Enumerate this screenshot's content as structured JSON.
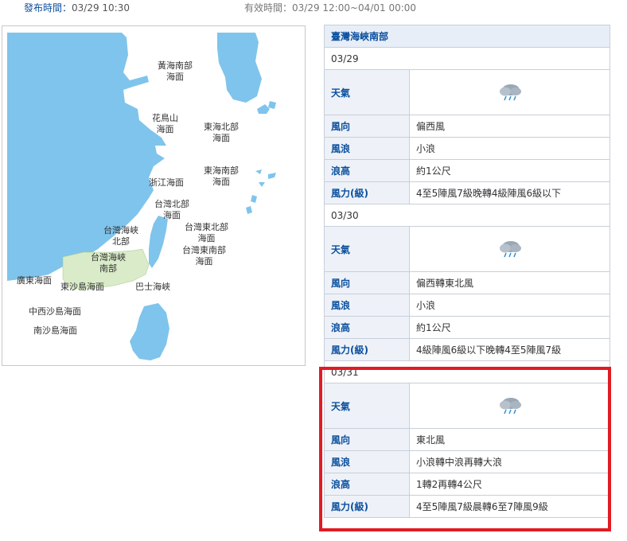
{
  "header": {
    "publish_label": "發布時間：",
    "publish_time": "03/29 10:30",
    "valid_label": "有效時間：",
    "valid_time": "03/29 12:00~04/01 00:00"
  },
  "map": {
    "regions": {
      "yellow_sea_south_a": "黃海南部",
      "yellow_sea_south_b": "海面",
      "huaniao_a": "花鳥山",
      "huaniao_b": "海面",
      "east_china_north_a": "東海北部",
      "east_china_north_b": "海面",
      "east_china_south_a": "東海南部",
      "east_china_south_b": "海面",
      "zhejiang": "浙江海面",
      "taiwan_north_a": "台灣北部",
      "taiwan_north_b": "海面",
      "taiwan_strait_north_a": "台灣海峽",
      "taiwan_strait_north_b": "北部",
      "taiwan_strait_south_a": "台灣海峽",
      "taiwan_strait_south_b": "南部",
      "taiwan_northeast_a": "台灣東北部",
      "taiwan_northeast_b": "海面",
      "taiwan_southeast_a": "台灣東南部",
      "taiwan_southeast_b": "海面",
      "guangdong": "廣東海面",
      "dongsha": "東沙島海面",
      "bashi": "巴士海峽",
      "zhongxisha": "中西沙島海面",
      "nansha": "南沙島海面"
    },
    "colors": {
      "land": "#7fc4ec",
      "selected": "#d9ebc8"
    }
  },
  "forecast": {
    "region_title": "臺灣海峽南部",
    "labels": {
      "weather": "天氣",
      "wind_dir": "風向",
      "wave": "風浪",
      "wave_height": "浪高",
      "wind_force": "風力(級)"
    },
    "days": [
      {
        "date": "03/29",
        "weather_icon": "rain-cloud-icon",
        "wind_dir": "偏西風",
        "wave": "小浪",
        "wave_height": "約1公尺",
        "wind_force": "4至5陣風7級晚轉4級陣風6級以下"
      },
      {
        "date": "03/30",
        "weather_icon": "rain-cloud-icon",
        "wind_dir": "偏西轉東北風",
        "wave": "小浪",
        "wave_height": "約1公尺",
        "wind_force": "4級陣風6級以下晚轉4至5陣風7級"
      },
      {
        "date": "03/31",
        "weather_icon": "rain-cloud-icon",
        "wind_dir": "東北風",
        "wave": "小浪轉中浪再轉大浪",
        "wave_height": "1轉2再轉4公尺",
        "wind_force": "4至5陣風7級晨轉6至7陣風9級"
      }
    ],
    "highlight_color": "#e01b24"
  }
}
